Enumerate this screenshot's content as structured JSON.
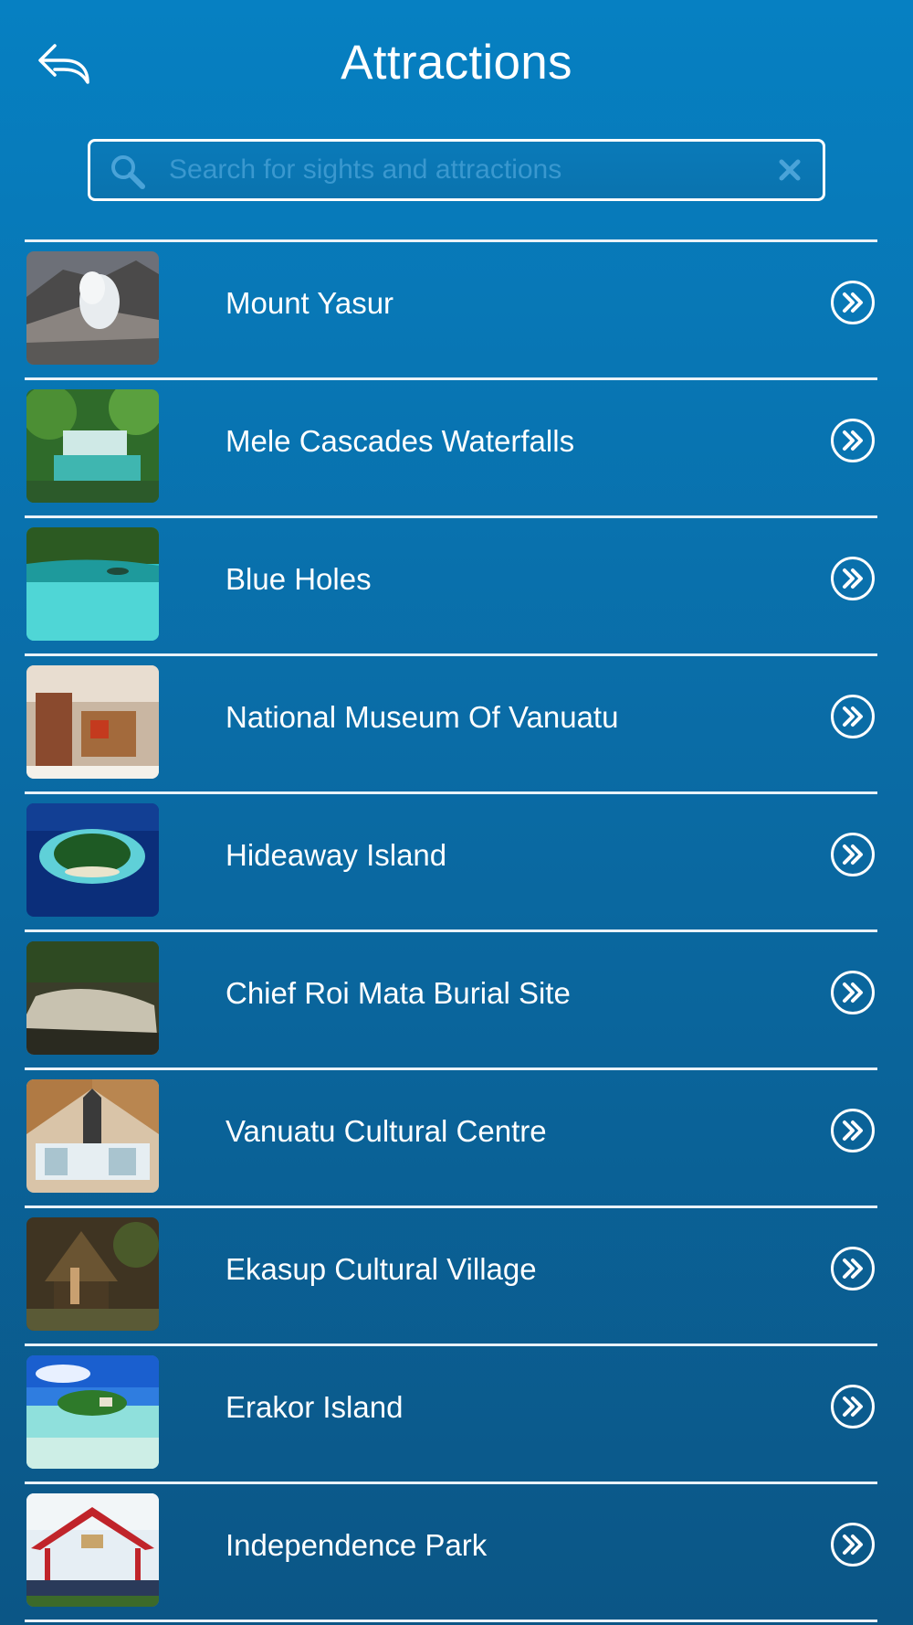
{
  "header": {
    "title": "Attractions",
    "back_icon": "back-reply-icon"
  },
  "search": {
    "placeholder": "Search for sights and attractions",
    "value": "",
    "icon": "search-icon",
    "clear_icon": "clear-icon"
  },
  "attractions": [
    {
      "name": "Mount Yasur",
      "thumb": "volcano-photo"
    },
    {
      "name": "Mele Cascades Waterfalls",
      "thumb": "waterfall-photo"
    },
    {
      "name": "Blue Holes",
      "thumb": "lagoon-photo"
    },
    {
      "name": "National Museum Of Vanuatu",
      "thumb": "museum-photo"
    },
    {
      "name": "Hideaway Island",
      "thumb": "island-aerial-photo"
    },
    {
      "name": "Chief Roi Mata Burial Site",
      "thumb": "burial-site-photo"
    },
    {
      "name": "Vanuatu Cultural Centre",
      "thumb": "cultural-centre-photo"
    },
    {
      "name": "Ekasup Cultural Village",
      "thumb": "village-photo"
    },
    {
      "name": "Erakor Island",
      "thumb": "tropical-island-photo"
    },
    {
      "name": "Independence Park",
      "thumb": "park-pavilion-photo"
    }
  ],
  "colors": {
    "background_top": "#0680c2",
    "background_bottom": "#0b5686",
    "divider": "#e9f2f8",
    "placeholder": "#3a98cf"
  }
}
